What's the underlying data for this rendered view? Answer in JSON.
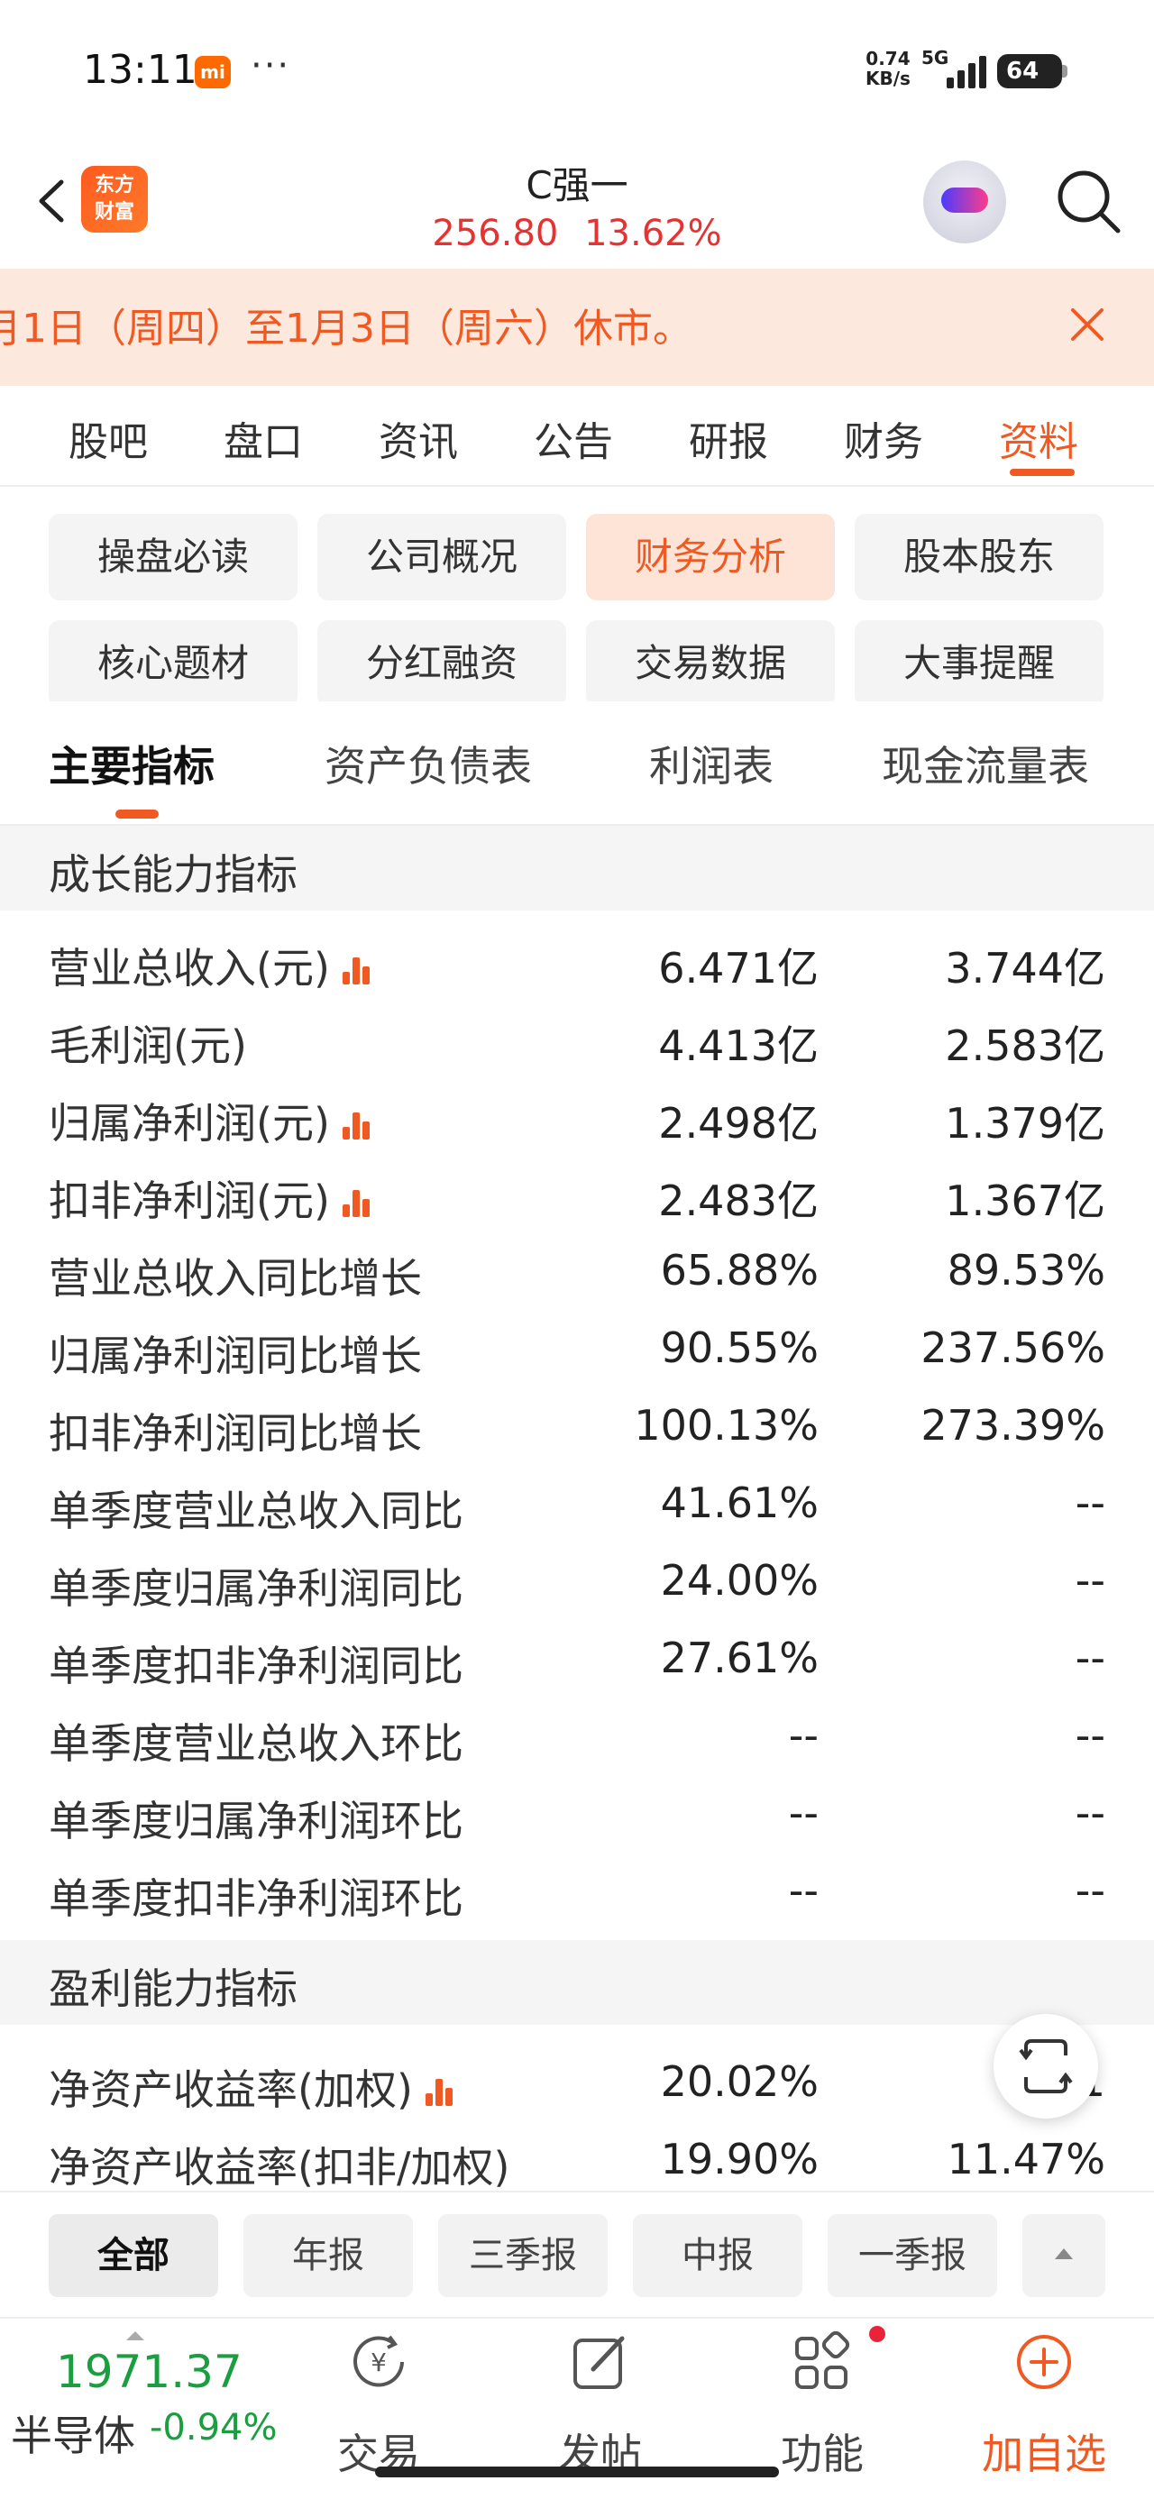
{
  "status_bar": {
    "time": "13:11",
    "mi_badge": "mi",
    "dots": "···",
    "net_speed_value": "0.74",
    "net_speed_unit": "KB/s",
    "network": "5G",
    "battery": "64"
  },
  "header": {
    "logo_text_line1": "东方",
    "logo_text_line2": "财富",
    "stock_name": "C强一",
    "price": "256.80",
    "change_pct": "13.62%",
    "price_color": "#e63232"
  },
  "notice": {
    "text": "月1日（周四）至1月3日（周六）休市。"
  },
  "main_tabs": [
    "股吧",
    "盘口",
    "资讯",
    "公告",
    "研报",
    "财务",
    "资料"
  ],
  "main_tab_active": "资料",
  "categories": [
    "操盘必读",
    "公司概况",
    "财务分析",
    "股本股东",
    "核心题材",
    "分红融资",
    "交易数据",
    "大事提醒"
  ],
  "category_active": "财务分析",
  "sub_tabs": [
    "主要指标",
    "资产负债表",
    "利润表",
    "现金流量表"
  ],
  "sub_tab_active": "主要指标",
  "sections": {
    "growth": {
      "title": "成长能力指标",
      "rows": [
        {
          "label": "营业总收入(元)",
          "v1": "6.471亿",
          "v2": "3.744亿",
          "chart": true
        },
        {
          "label": "毛利润(元)",
          "v1": "4.413亿",
          "v2": "2.583亿",
          "chart": false
        },
        {
          "label": "归属净利润(元)",
          "v1": "2.498亿",
          "v2": "1.379亿",
          "chart": true
        },
        {
          "label": "扣非净利润(元)",
          "v1": "2.483亿",
          "v2": "1.367亿",
          "chart": true
        },
        {
          "label": "营业总收入同比增长",
          "v1": "65.88%",
          "v2": "89.53%",
          "chart": false
        },
        {
          "label": "归属净利润同比增长",
          "v1": "90.55%",
          "v2": "237.56%",
          "chart": false
        },
        {
          "label": "扣非净利润同比增长",
          "v1": "100.13%",
          "v2": "273.39%",
          "chart": false
        },
        {
          "label": "单季度营业总收入同比",
          "v1": "41.61%",
          "v2": "--",
          "chart": false
        },
        {
          "label": "单季度归属净利润同比",
          "v1": "24.00%",
          "v2": "--",
          "chart": false
        },
        {
          "label": "单季度扣非净利润同比",
          "v1": "27.61%",
          "v2": "--",
          "chart": false
        },
        {
          "label": "单季度营业总收入环比",
          "v1": "--",
          "v2": "--",
          "chart": false
        },
        {
          "label": "单季度归属净利润环比",
          "v1": "--",
          "v2": "--",
          "chart": false
        },
        {
          "label": "单季度扣非净利润环比",
          "v1": "--",
          "v2": "--",
          "chart": false
        }
      ]
    },
    "profit": {
      "title": "盈利能力指标",
      "rows": [
        {
          "label": "净资产收益率(加权)",
          "v1": "20.02%",
          "v2": "1",
          "chart": true
        },
        {
          "label": "净资产收益率(扣非/加权)",
          "v1": "19.90%",
          "v2": "11.47%",
          "chart": false
        }
      ]
    }
  },
  "period_filters": [
    "全部",
    "年报",
    "三季报",
    "中报",
    "一季报"
  ],
  "period_active": "全部",
  "bottom_nav": {
    "index_value": "1971.37",
    "index_name": "半导体",
    "index_change": "-0.94%",
    "items": [
      {
        "label": "交易",
        "icon": "yuan-circle-icon"
      },
      {
        "label": "发帖",
        "icon": "edit-icon"
      },
      {
        "label": "功能",
        "icon": "grid-icon"
      },
      {
        "label": "加自选",
        "icon": "plus-circle-icon"
      }
    ]
  },
  "colors": {
    "accent": "#f05a22",
    "price_up": "#e63232",
    "price_down": "#1a9e3f",
    "notice_bg": "#fde8dd"
  }
}
